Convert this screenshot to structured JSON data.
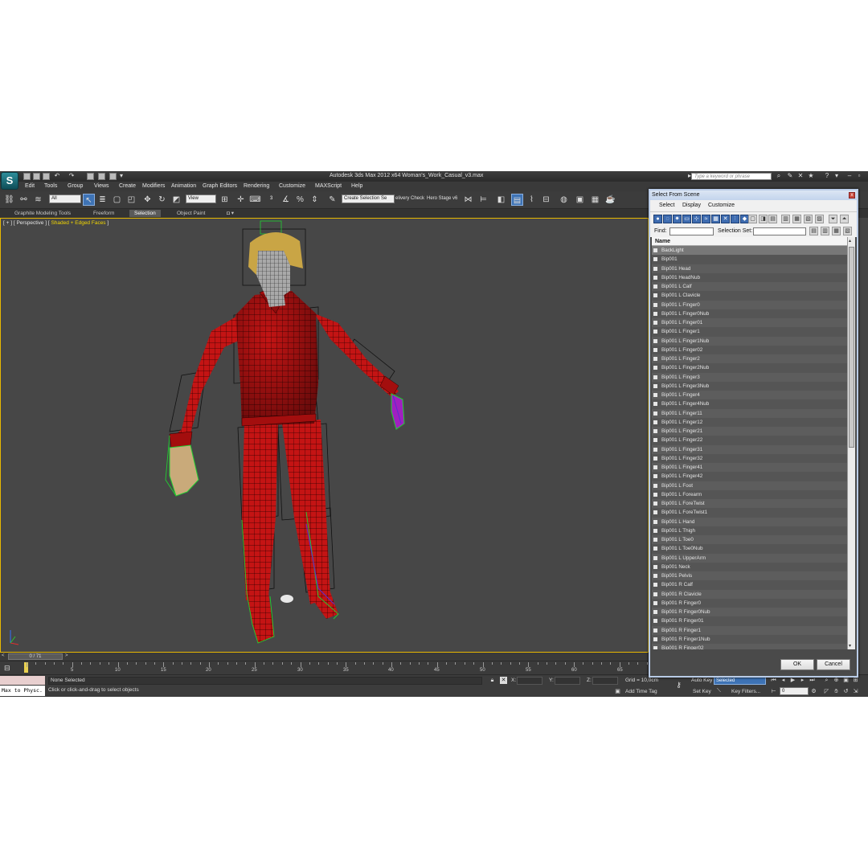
{
  "window": {
    "title": "Autodesk 3ds Max  2012 x64      Woman's_Work_Casual_v3.max",
    "search_placeholder": "Type a keyword or phrase",
    "logo_letter": "S"
  },
  "menu": [
    "Edit",
    "Tools",
    "Group",
    "Views",
    "Create",
    "Modifiers",
    "Animation",
    "Graph Editors",
    "Rendering",
    "Customize",
    "MAXScript",
    "Help"
  ],
  "toolbar": {
    "filter_value": "All",
    "refcoord_value": "View",
    "selection_set_value": "Create Selection Se",
    "delivery_label": "elivery Check",
    "hero_label": "Hero Stage v6"
  },
  "ribbon": {
    "tabs": [
      {
        "label": "Graphite Modeling Tools",
        "active": false
      },
      {
        "label": "Freeform",
        "active": false
      },
      {
        "label": "Selection",
        "active": true
      },
      {
        "label": "Object Paint",
        "active": false
      }
    ],
    "dot": "◘ ▾"
  },
  "viewport": {
    "label_prefix": "[ + ] [ ",
    "view_name": "Perspective",
    "label_mid": " ] [ ",
    "shading": "Shaded + Edged Faces",
    "label_suffix": " ]"
  },
  "timeline": {
    "position": "0 / 71",
    "ticks": [
      "5",
      "10",
      "15",
      "20",
      "25",
      "30",
      "35",
      "40",
      "45",
      "50",
      "55",
      "60",
      "65"
    ]
  },
  "status": {
    "maxscript": "Max to Physc.",
    "selection": "None Selected",
    "prompt": "Click or click-and-drag to select objects",
    "x_label": "X:",
    "y_label": "Y:",
    "z_label": "Z:",
    "grid": "Grid = 10,0cm",
    "add_time_tag": "Add Time Tag",
    "auto_key": "Auto Key",
    "auto_key_value": "Selected",
    "set_key": "Set Key",
    "key_filters": "Key Filters...",
    "frame_value": "0"
  },
  "dialog": {
    "title": "Select From Scene",
    "close": "x",
    "menu": [
      "Select",
      "Display",
      "Customize"
    ],
    "find_label": "Find:",
    "selection_set_label": "Selection Set:",
    "column_header": "Name",
    "ok": "OK",
    "cancel": "Cancel",
    "items": [
      "BackLight",
      "Bip001",
      "Bip001 Head",
      "Bip001 HeadNub",
      "Bip001 L Calf",
      "Bip001 L Clavicle",
      "Bip001 L Finger0",
      "Bip001 L Finger0Nub",
      "Bip001 L Finger01",
      "Bip001 L Finger1",
      "Bip001 L Finger1Nub",
      "Bip001 L Finger02",
      "Bip001 L Finger2",
      "Bip001 L Finger2Nub",
      "Bip001 L Finger3",
      "Bip001 L Finger3Nub",
      "Bip001 L Finger4",
      "Bip001 L Finger4Nub",
      "Bip001 L Finger11",
      "Bip001 L Finger12",
      "Bip001 L Finger21",
      "Bip001 L Finger22",
      "Bip001 L Finger31",
      "Bip001 L Finger32",
      "Bip001 L Finger41",
      "Bip001 L Finger42",
      "Bip001 L Foot",
      "Bip001 L Forearm",
      "Bip001 L ForeTwist",
      "Bip001 L ForeTwist1",
      "Bip001 L Hand",
      "Bip001 L Thigh",
      "Bip001 L Toe0",
      "Bip001 L Toe0Nub",
      "Bip001 L UpperArm",
      "Bip001 Neck",
      "Bip001 Pelvis",
      "Bip001 R Calf",
      "Bip001 R Clavicle",
      "Bip001 R Finger0",
      "Bip001 R Finger0Nub",
      "Bip001 R Finger01",
      "Bip001 R Finger1",
      "Bip001 R Finger1Nub",
      "Bip001 R Finger02"
    ]
  },
  "colors": {
    "viewport_border": "#e8b800",
    "model_red": "#c41414",
    "bone_green": "#20d030",
    "selection_blue": "#3e73b5"
  }
}
